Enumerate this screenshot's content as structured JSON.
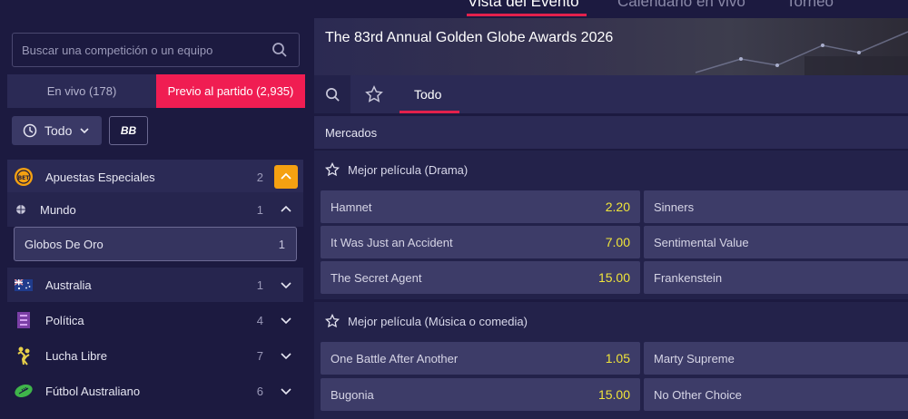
{
  "topnav": {
    "tabs": [
      "Vista del Evento",
      "Calendario en vivo",
      "Torneo"
    ]
  },
  "search": {
    "placeholder": "Buscar una competición o un equipo"
  },
  "toggle": {
    "live": "En vivo (178)",
    "pre": "Previo al partido (2,935)"
  },
  "filters": {
    "todo": "Todo",
    "bb": "BB"
  },
  "categories": [
    {
      "name": "Apuestas Especiales",
      "count": "2",
      "icon": "bet-icon"
    },
    {
      "name": "Mundo",
      "count": "1",
      "icon": "globe-icon"
    },
    {
      "name": "Globos De Oro",
      "count": "1"
    },
    {
      "name": "Australia",
      "count": "1",
      "icon": "australia-flag-icon"
    },
    {
      "name": "Política",
      "count": "4",
      "icon": "politics-icon"
    },
    {
      "name": "Lucha Libre",
      "count": "7",
      "icon": "wrestling-icon"
    },
    {
      "name": "Fútbol Australiano",
      "count": "6",
      "icon": "aussie-football-icon"
    }
  ],
  "event": {
    "title": "The 83rd Annual Golden Globe Awards 2026"
  },
  "tabs": {
    "todo": "Todo"
  },
  "mercados": "Mercados",
  "markets": [
    {
      "title": "Mejor película (Drama)",
      "rows": [
        [
          {
            "name": "Hamnet",
            "price": "2.20"
          },
          {
            "name": "Sinners",
            "price": ""
          }
        ],
        [
          {
            "name": "It Was Just an Accident",
            "price": "7.00"
          },
          {
            "name": "Sentimental Value",
            "price": ""
          }
        ],
        [
          {
            "name": "The Secret Agent",
            "price": "15.00"
          },
          {
            "name": "Frankenstein",
            "price": ""
          }
        ]
      ]
    },
    {
      "title": "Mejor película (Música o comedia)",
      "rows": [
        [
          {
            "name": "One Battle After Another",
            "price": "1.05"
          },
          {
            "name": "Marty Supreme",
            "price": ""
          }
        ],
        [
          {
            "name": "Bugonia",
            "price": "15.00"
          },
          {
            "name": "No Other Choice",
            "price": ""
          }
        ]
      ]
    }
  ],
  "colors": {
    "accent": "#f01d52",
    "odds": "#f0e53a",
    "chevron_active": "#f5a111"
  }
}
